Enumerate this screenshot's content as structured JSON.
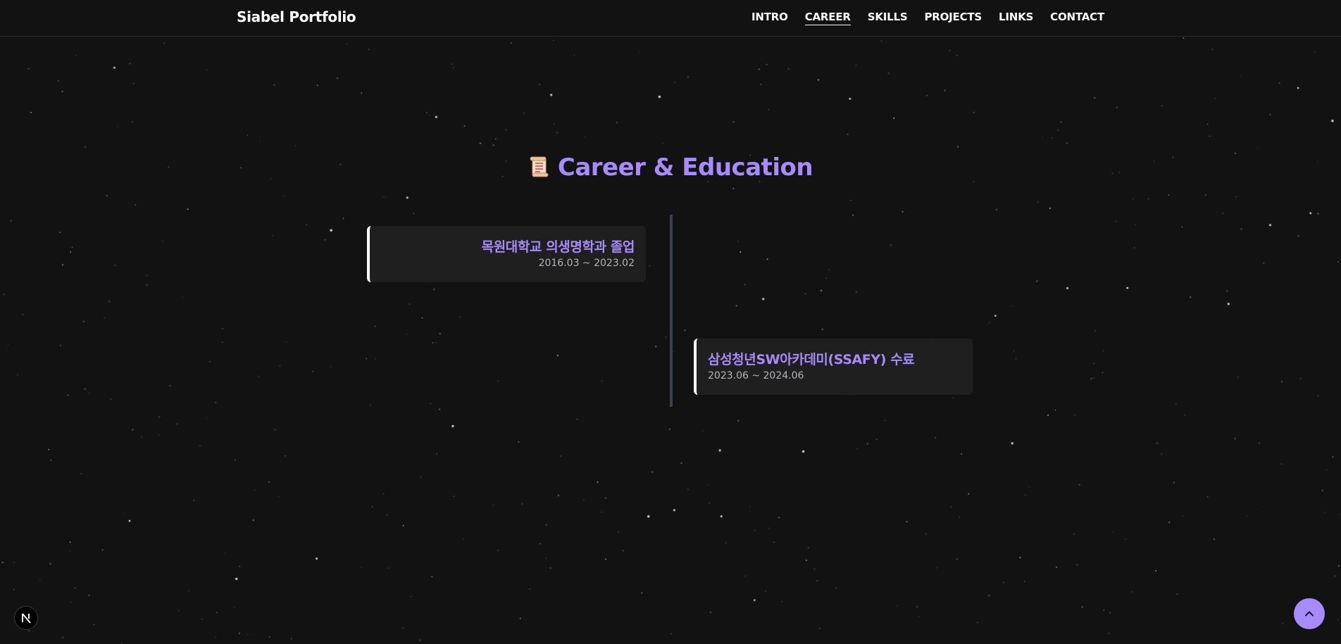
{
  "header": {
    "brand": "Siabel Portfolio",
    "nav": [
      {
        "label": "INTRO",
        "active": false
      },
      {
        "label": "CAREER",
        "active": true
      },
      {
        "label": "SKILLS",
        "active": false
      },
      {
        "label": "PROJECTS",
        "active": false
      },
      {
        "label": "LINKS",
        "active": false
      },
      {
        "label": "CONTACT",
        "active": false
      }
    ]
  },
  "career": {
    "title": "Career & Education",
    "title_icon": "scroll-icon",
    "items": [
      {
        "title": "목원대학교 의생명학과 졸업",
        "period": "2016.03 ~ 2023.02",
        "side": "left"
      },
      {
        "title": "삼성청년SW아카데미(SSAFY) 수료",
        "period": "2023.06 ~ 2024.06",
        "side": "right"
      }
    ]
  },
  "floating": {
    "next_badge_icon": "nextjs-logo-icon",
    "scroll_top_icon": "chevron-up-icon"
  },
  "colors": {
    "background": "#121213",
    "accent": "#a78bfa",
    "card": "#1f1f20",
    "timeline": "#3a3f52"
  }
}
